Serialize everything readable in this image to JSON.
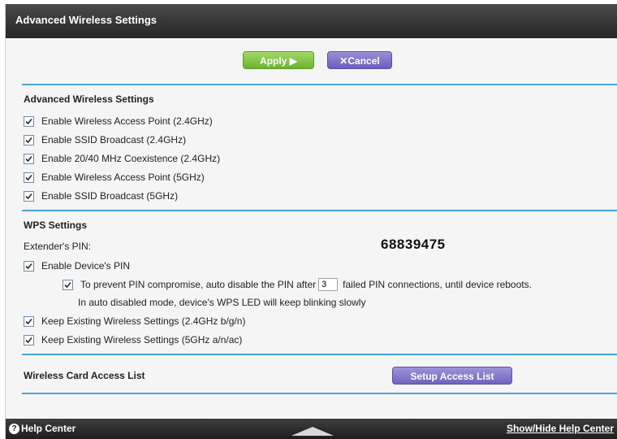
{
  "header": {
    "title": "Advanced Wireless Settings"
  },
  "buttons": {
    "apply": "Apply ▶",
    "cancel": "✕Cancel"
  },
  "advanced_section": {
    "title": "Advanced Wireless Settings",
    "options": [
      {
        "label": "Enable Wireless Access Point (2.4GHz)",
        "checked": true
      },
      {
        "label": "Enable SSID Broadcast (2.4GHz)",
        "checked": true
      },
      {
        "label": "Enable 20/40 MHz Coexistence (2.4GHz)",
        "checked": true
      },
      {
        "label": "Enable Wireless Access Point (5GHz)",
        "checked": true
      },
      {
        "label": "Enable SSID Broadcast (5GHz)",
        "checked": true
      }
    ]
  },
  "wps_section": {
    "title": "WPS Settings",
    "pin_label": "Extender's PIN:",
    "pin_value": "68839475",
    "enable_pin_label": "Enable Device's PIN",
    "prevent_before": "To prevent PIN compromise, auto disable the PIN after",
    "prevent_value": "3",
    "prevent_after": "failed PIN connections, until device reboots.",
    "auto_disabled_note": "In auto disabled mode, device's WPS LED will keep blinking slowly",
    "keep_24": "Keep Existing Wireless Settings (2.4GHz b/g/n)",
    "keep_5": "Keep Existing Wireless Settings (5GHz a/n/ac)"
  },
  "access_list": {
    "title": "Wireless Card Access List",
    "button": "Setup Access List"
  },
  "footer": {
    "help": "Help Center",
    "toggle": "Show/Hide Help Center"
  },
  "icons": {
    "help": "help-circle-icon",
    "check": "checkmark-icon",
    "toggle": "arrow-up-icon"
  },
  "colors": {
    "accent": "#4aa3d8",
    "apply": "#7cc242",
    "cancel": "#7a6bc8"
  }
}
